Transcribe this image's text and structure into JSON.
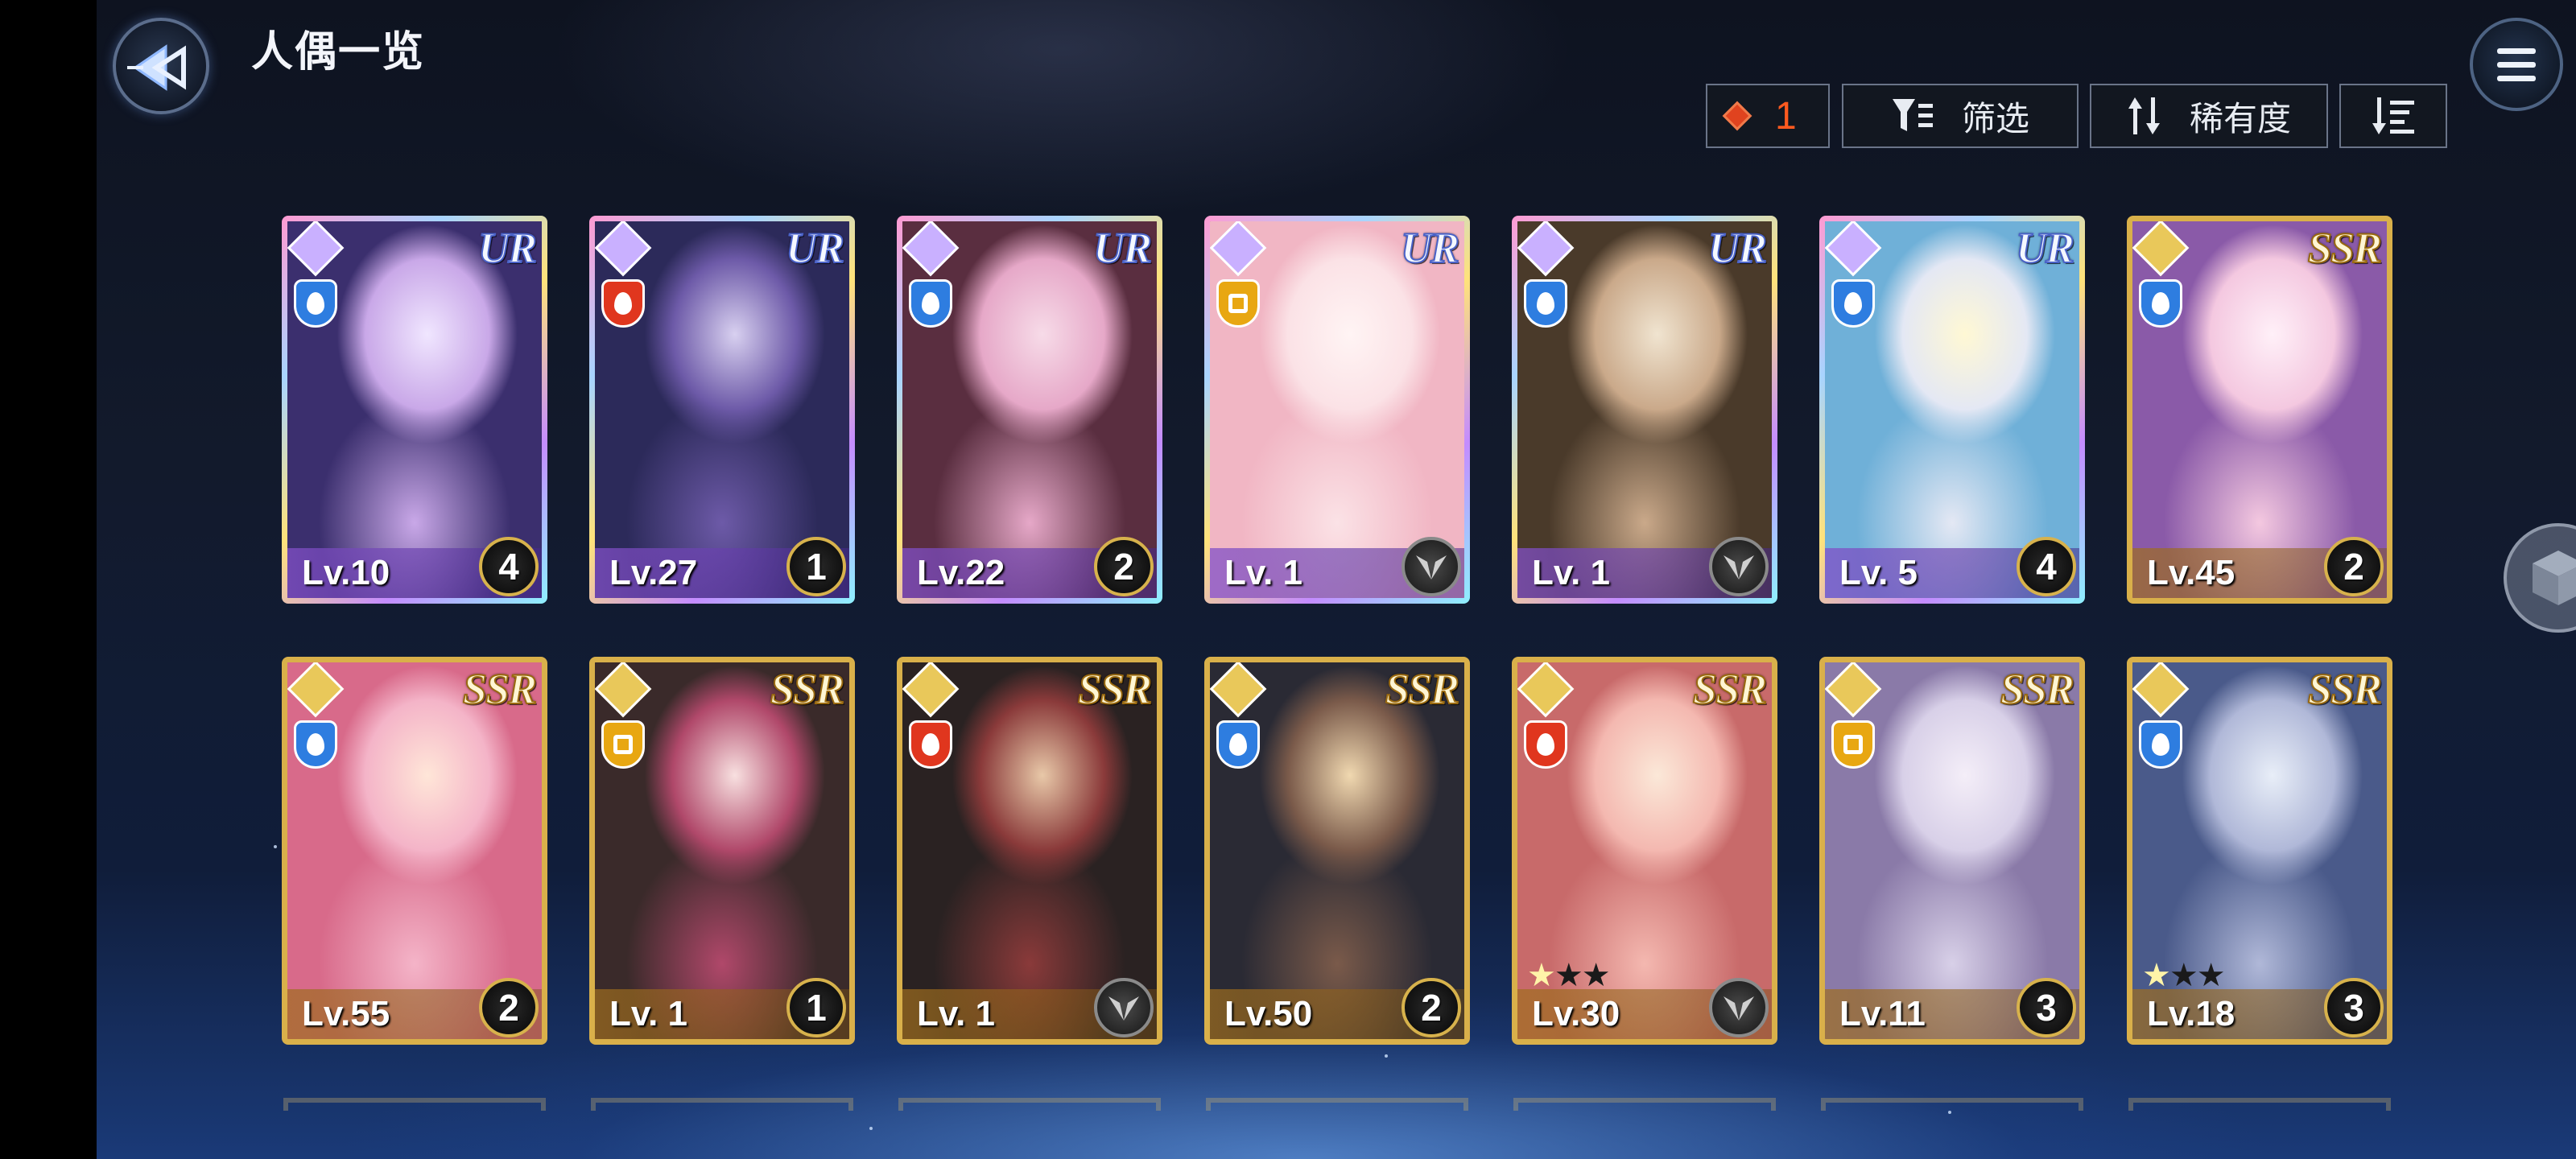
{
  "header": {
    "title": "人偶一览",
    "back_icon": "back-arrow-icon",
    "menu_icon": "hamburger-menu-icon"
  },
  "toolbar": {
    "count_value": "1",
    "filter_label": "筛选",
    "rarity_label": "稀有度",
    "accent_color": "#ff5a1f"
  },
  "cards": [
    {
      "rarity": "UR",
      "element": "water",
      "level": "Lv.10",
      "badge": "4"
    },
    {
      "rarity": "UR",
      "element": "fire",
      "level": "Lv.27",
      "badge": "1"
    },
    {
      "rarity": "UR",
      "element": "water",
      "level": "Lv.22",
      "badge": "2"
    },
    {
      "rarity": "UR",
      "element": "light",
      "level": "Lv. 1",
      "badge": ""
    },
    {
      "rarity": "UR",
      "element": "water",
      "level": "Lv. 1",
      "badge": ""
    },
    {
      "rarity": "UR",
      "element": "water",
      "level": "Lv. 5",
      "badge": "4"
    },
    {
      "rarity": "SSR",
      "element": "water",
      "level": "Lv.45",
      "badge": "2"
    },
    {
      "rarity": "SSR",
      "element": "water",
      "level": "Lv.55",
      "badge": "2"
    },
    {
      "rarity": "SSR",
      "element": "light",
      "level": "Lv. 1",
      "badge": "1"
    },
    {
      "rarity": "SSR",
      "element": "fire",
      "level": "Lv. 1",
      "badge": ""
    },
    {
      "rarity": "SSR",
      "element": "water",
      "level": "Lv.50",
      "badge": "2"
    },
    {
      "rarity": "SSR",
      "element": "fire",
      "level": "Lv.30",
      "badge": "",
      "stars": "★★★"
    },
    {
      "rarity": "SSR",
      "element": "light",
      "level": "Lv.11",
      "badge": "3"
    },
    {
      "rarity": "SSR",
      "element": "water",
      "level": "Lv.18",
      "badge": "3",
      "stars": "★★★"
    }
  ]
}
